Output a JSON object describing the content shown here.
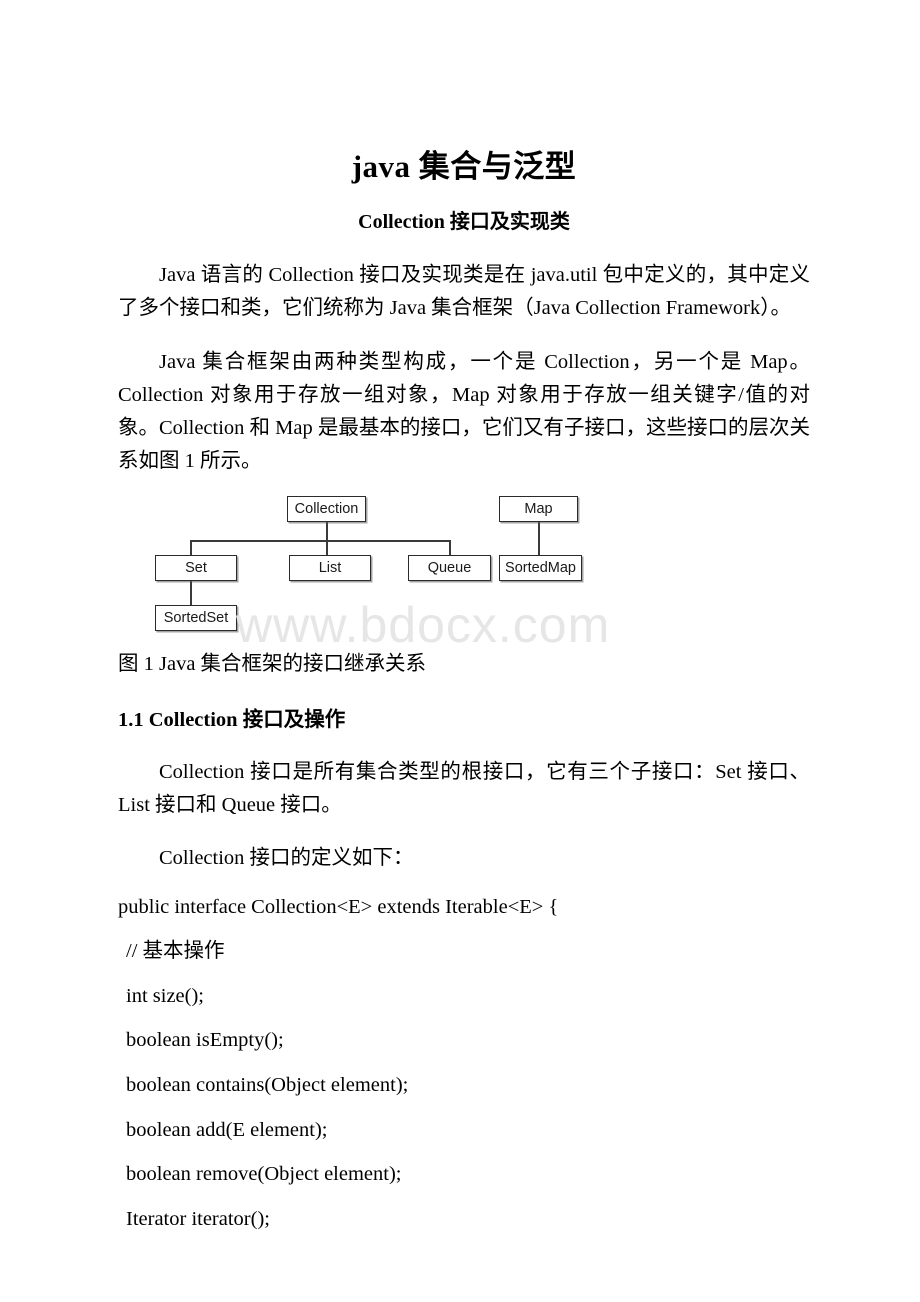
{
  "document": {
    "title": "java 集合与泛型",
    "subtitle": "Collection 接口及实现类",
    "watermark": "www.bdocx.com"
  },
  "paragraphs": {
    "p1": "Java 语言的 Collection 接口及实现类是在 java.util 包中定义的，其中定义了多个接口和类，它们统称为 Java 集合框架（Java Collection Framework）。",
    "p2": "Java 集合框架由两种类型构成，一个是 Collection，另一个是 Map。Collection 对象用于存放一组对象，Map 对象用于存放一组关键字/值的对象。Collection 和 Map 是最基本的接口，它们又有子接口，这些接口的层次关系如图 1 所示。",
    "p3": "Collection 接口是所有集合类型的根接口，它有三个子接口：Set 接口、List 接口和 Queue 接口。",
    "p4": "Collection 接口的定义如下："
  },
  "figure": {
    "caption": "图 1 Java 集合框架的接口继承关系",
    "boxes": {
      "collection": "Collection",
      "set": "Set",
      "list": "List",
      "queue": "Queue",
      "sorted_set": "SortedSet",
      "map": "Map",
      "sorted_map": "SortedMap"
    }
  },
  "headings": {
    "s11": "1.1 Collection 接口及操作"
  },
  "code": {
    "line1": "public interface Collection<E> extends Iterable<E> {",
    "line2": "// 基本操作",
    "line3": "int size();",
    "line4": "boolean isEmpty();",
    "line5": "boolean contains(Object element);",
    "line6": "boolean add(E element);",
    "line7": "boolean remove(Object element);",
    "line8": "Iterator iterator();"
  }
}
